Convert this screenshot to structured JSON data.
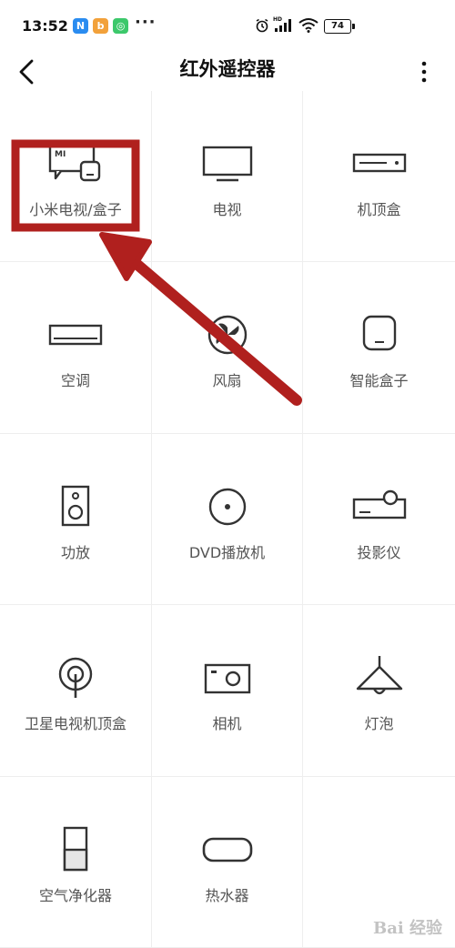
{
  "status_bar": {
    "time": "13:52",
    "battery": "74",
    "more": "···",
    "icons": [
      "n-app-icon",
      "bb-app-icon",
      "mi-shield-icon",
      "alarm-icon",
      "hd-signal-icon",
      "wifi-icon",
      "battery-icon"
    ]
  },
  "header": {
    "title": "红外遥控器",
    "back_icon": "back-arrow-icon",
    "menu_icon": "more-vertical-icon"
  },
  "devices": [
    {
      "label": "小米电视/盒子",
      "icon": "mi-tv-box-icon"
    },
    {
      "label": "电视",
      "icon": "tv-icon"
    },
    {
      "label": "机顶盒",
      "icon": "set-top-box-icon"
    },
    {
      "label": "空调",
      "icon": "air-conditioner-icon"
    },
    {
      "label": "风扇",
      "icon": "fan-icon"
    },
    {
      "label": "智能盒子",
      "icon": "smart-box-icon"
    },
    {
      "label": "功放",
      "icon": "amplifier-icon"
    },
    {
      "label": "DVD播放机",
      "icon": "dvd-icon"
    },
    {
      "label": "投影仪",
      "icon": "projector-icon"
    },
    {
      "label": "卫星电视机顶盒",
      "icon": "satellite-icon"
    },
    {
      "label": "相机",
      "icon": "camera-icon"
    },
    {
      "label": "灯泡",
      "icon": "lamp-icon"
    },
    {
      "label": "空气净化器",
      "icon": "air-purifier-icon"
    },
    {
      "label": "热水器",
      "icon": "water-heater-icon"
    }
  ],
  "annotation": {
    "highlight_color": "#b0201e",
    "arrow_color": "#b0201e"
  },
  "watermark": "Bai 经验"
}
